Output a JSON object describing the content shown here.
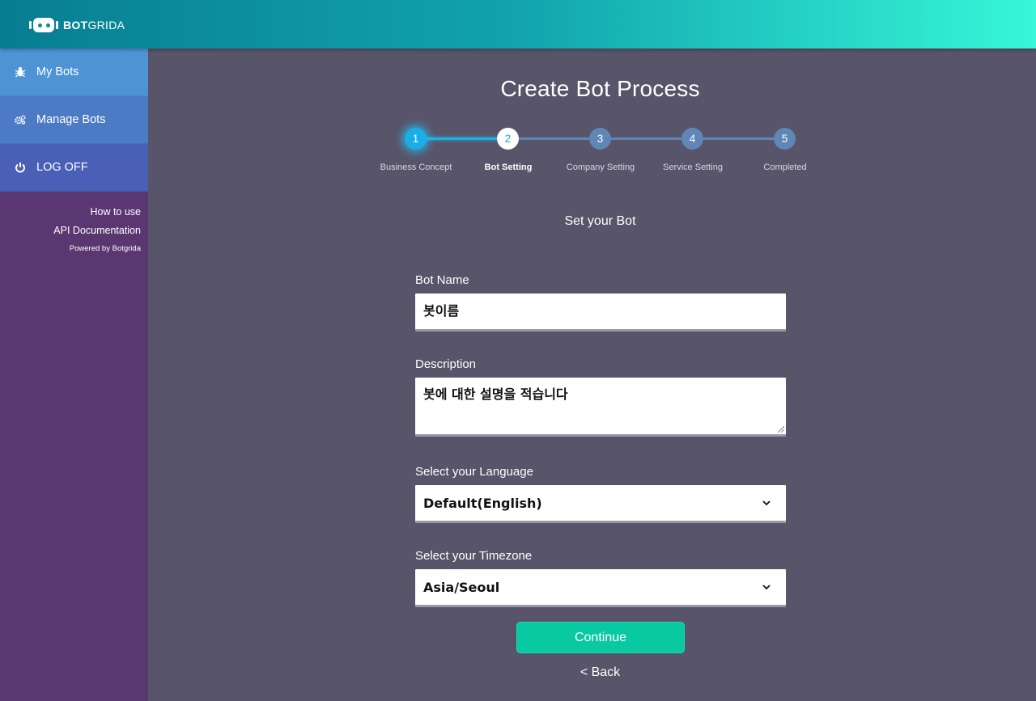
{
  "header": {
    "logo_text_bold": "BOT",
    "logo_text_rest": "GRIDA"
  },
  "sidebar": {
    "items": [
      {
        "label": "My Bots",
        "icon": "bug-icon"
      },
      {
        "label": "Manage Bots",
        "icon": "gears-icon"
      },
      {
        "label": "LOG OFF",
        "icon": "power-icon"
      }
    ],
    "links": {
      "how_to_use": "How to use",
      "api_docs": "API Documentation",
      "powered_by": "Powered by Botgrida"
    }
  },
  "main": {
    "title": "Create Bot Process",
    "subtitle": "Set your Bot",
    "steps": [
      {
        "number": "1",
        "label": "Business Concept",
        "state": "done"
      },
      {
        "number": "2",
        "label": "Bot Setting",
        "state": "current"
      },
      {
        "number": "3",
        "label": "Company Setting",
        "state": "pending"
      },
      {
        "number": "4",
        "label": "Service Setting",
        "state": "pending"
      },
      {
        "number": "5",
        "label": "Completed",
        "state": "pending"
      }
    ],
    "form": {
      "bot_name_label": "Bot Name",
      "bot_name_value": "봇이름",
      "description_label": "Description",
      "description_value": "봇에 대한 설명을 적습니다",
      "language_label": "Select your Language",
      "language_value": "Default(English)",
      "timezone_label": "Select your Timezone",
      "timezone_value": "Asia/Seoul"
    },
    "continue_label": "Continue",
    "back_label": "< Back"
  },
  "colors": {
    "accent": "#09c9a2",
    "step_done": "#19aee8",
    "step_pending": "#5f86b5",
    "background": "#58546a",
    "sidebar": "#5a3770"
  }
}
